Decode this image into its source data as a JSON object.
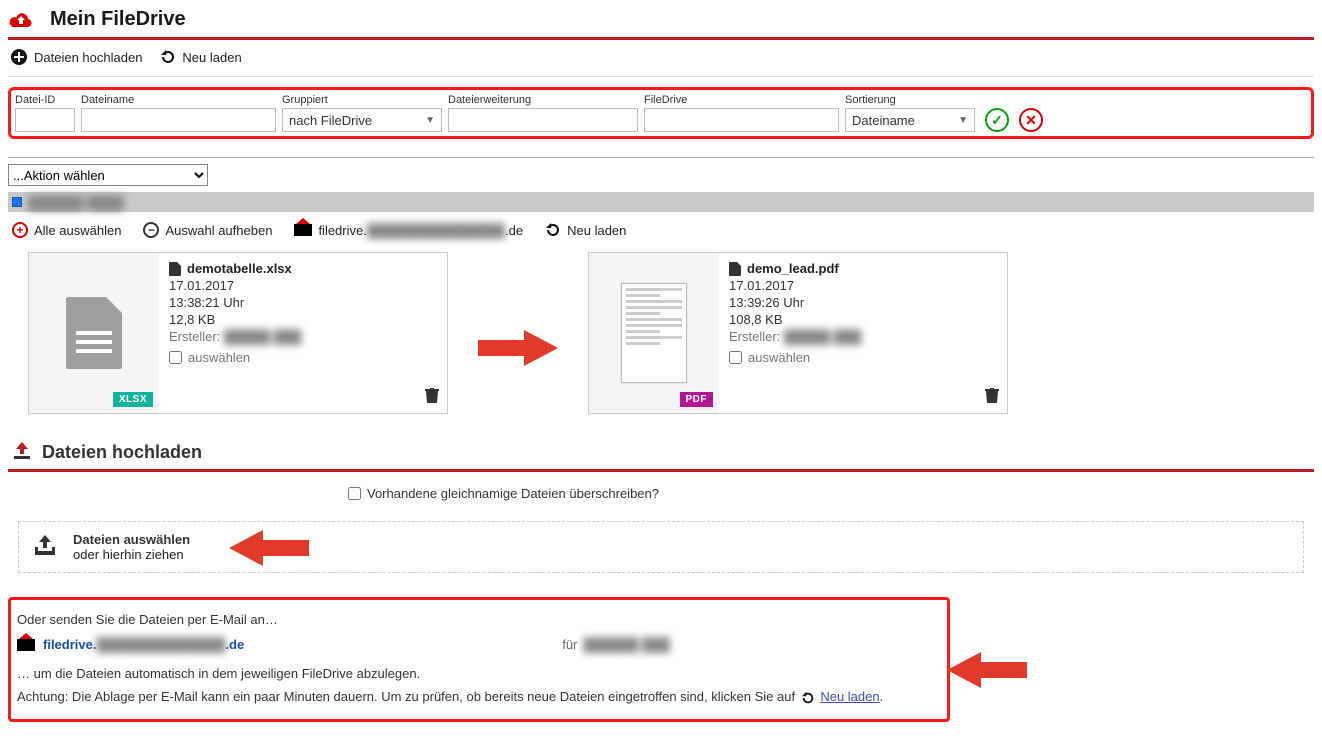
{
  "header": {
    "title": "Mein FileDrive"
  },
  "toolbar": {
    "upload": "Dateien hochladen",
    "reload": "Neu laden"
  },
  "filters": {
    "file_id": {
      "label": "Datei-ID",
      "value": ""
    },
    "filename": {
      "label": "Dateiname",
      "value": ""
    },
    "grouped": {
      "label": "Gruppiert",
      "value": "nach FileDrive"
    },
    "extension": {
      "label": "Dateierweiterung",
      "value": ""
    },
    "filedrive": {
      "label": "FileDrive",
      "value": ""
    },
    "sort": {
      "label": "Sortierung",
      "value": "Dateiname"
    }
  },
  "action_select": {
    "placeholder": "...Aktion wählen"
  },
  "filebar": {
    "select_all": "Alle auswählen",
    "deselect": "Auswahl aufheben",
    "email_prefix": "filedrive.",
    "email_suffix": ".de",
    "reload": "Neu laden"
  },
  "files": [
    {
      "name": "demotabelle.xlsx",
      "date": "17.01.2017",
      "time": "13:38:21 Uhr",
      "size": "12,8 KB",
      "creator_label": "Ersteller:",
      "select_label": "auswählen",
      "badge": "XLSX"
    },
    {
      "name": "demo_lead.pdf",
      "date": "17.01.2017",
      "time": "13:39:26 Uhr",
      "size": "108,8 KB",
      "creator_label": "Ersteller:",
      "select_label": "auswählen",
      "badge": "PDF"
    }
  ],
  "upload_section": {
    "title": "Dateien hochladen",
    "overwrite_label": "Vorhandene gleichnamige Dateien überschreiben?",
    "choose_l1": "Dateien auswählen",
    "choose_l2": "oder hierhin ziehen"
  },
  "email_section": {
    "intro": "Oder senden Sie die Dateien per E-Mail an…",
    "addr_prefix": "filedrive.",
    "addr_suffix": ".de",
    "for_label": "für",
    "desc": "… um die Dateien automatisch in dem jeweiligen FileDrive abzulegen.",
    "warn_pre": "Achtung: Die Ablage per E-Mail kann ein paar Minuten dauern. Um zu prüfen, ob bereits neue Dateien eingetroffen sind, klicken Sie auf",
    "reload_link": "Neu laden"
  }
}
